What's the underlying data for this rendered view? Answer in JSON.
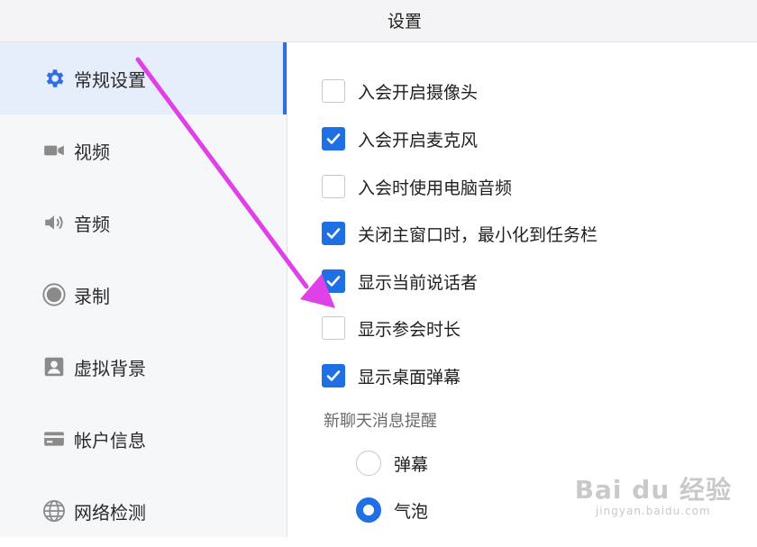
{
  "window": {
    "title": "设置"
  },
  "sidebar": {
    "items": [
      {
        "label": "常规设置",
        "icon": "gear-icon",
        "active": true
      },
      {
        "label": "视频",
        "icon": "video-camera-icon"
      },
      {
        "label": "音频",
        "icon": "speaker-icon"
      },
      {
        "label": "录制",
        "icon": "record-icon"
      },
      {
        "label": "虚拟背景",
        "icon": "person-portrait-icon"
      },
      {
        "label": "帐户信息",
        "icon": "card-icon"
      },
      {
        "label": "网络检测",
        "icon": "globe-icon"
      }
    ]
  },
  "settings": {
    "options": [
      {
        "label": "入会开启摄像头",
        "checked": false
      },
      {
        "label": "入会开启麦克风",
        "checked": true
      },
      {
        "label": "入会时使用电脑音频",
        "checked": false
      },
      {
        "label": "关闭主窗口时，最小化到任务栏",
        "checked": true
      },
      {
        "label": "显示当前说话者",
        "checked": true
      },
      {
        "label": "显示参会时长",
        "checked": false
      },
      {
        "label": "显示桌面弹幕",
        "checked": true
      }
    ],
    "notification": {
      "label": "新聊天消息提醒",
      "choices": [
        {
          "label": "弹幕",
          "selected": false
        },
        {
          "label": "气泡",
          "selected": true
        }
      ]
    }
  },
  "watermark": {
    "line1": "Bai du 经验",
    "line2": "jingyan.baidu.com"
  },
  "colors": {
    "accent": "#1f6fe5",
    "annotation_arrow": "#e040e8"
  }
}
